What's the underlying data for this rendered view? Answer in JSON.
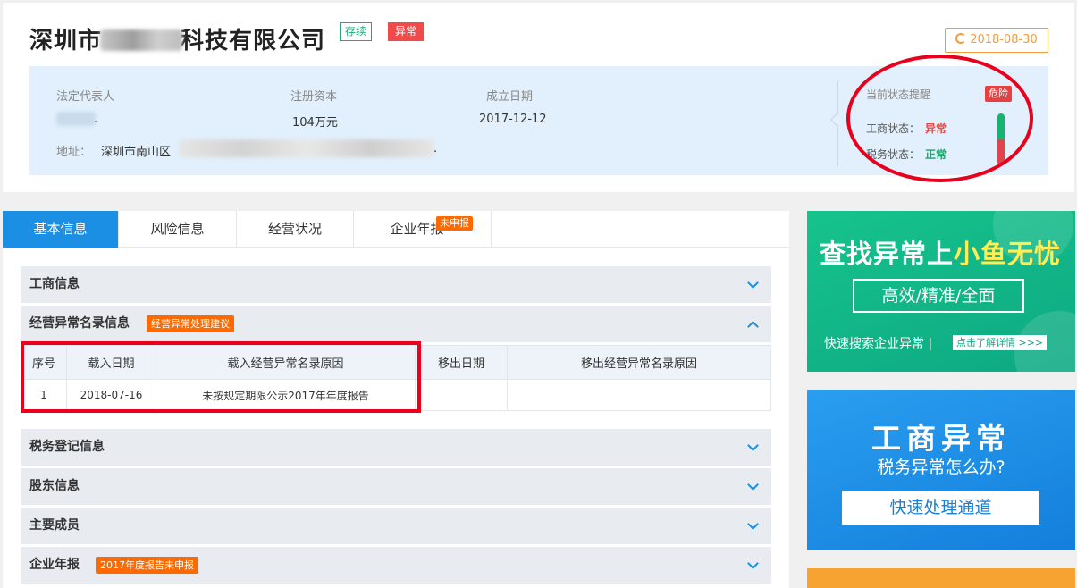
{
  "header": {
    "title_part1": "深圳市",
    "title_part2": "科技有限公司",
    "badge_status": "存续",
    "badge_abnormal": "异常",
    "date": "2018-08-30"
  },
  "info": {
    "legal_rep_label": "法定代表人",
    "capital_label": "注册资本",
    "capital_value": "104万元",
    "founded_label": "成立日期",
    "founded_value": "2017-12-12",
    "address_label": "地址：",
    "address_value": "深圳市南山区"
  },
  "status_panel": {
    "title": "当前状态提醒",
    "danger_label": "危险",
    "biz_label": "工商状态：",
    "biz_value": "异常",
    "tax_label": "税务状态：",
    "tax_value": "正常"
  },
  "tabs": [
    {
      "label": "基本信息"
    },
    {
      "label": "风险信息"
    },
    {
      "label": "经营状况"
    },
    {
      "label": "企业年报",
      "tag": "未申报"
    }
  ],
  "sections": {
    "s1": "工商信息",
    "s2": "经营异常名录信息",
    "s2_tag": "经营异常处理建议",
    "s3": "税务登记信息",
    "s4": "股东信息",
    "s5": "主要成员",
    "s6": "企业年报",
    "s6_tag": "2017年度报告未申报"
  },
  "abnormal_table": {
    "headers": [
      "序号",
      "载入日期",
      "载入经营异常名录原因",
      "移出日期",
      "移出经营异常名录原因"
    ],
    "rows": [
      [
        "1",
        "2018-07-16",
        "未按规定期限公示2017年年度报告",
        "",
        ""
      ]
    ]
  },
  "ads": {
    "green_headline": "查找异常上",
    "green_headline_highlight": "小鱼无忧",
    "green_pill": "高效/精准/全面",
    "green_tagline": "快速搜索企业异常 |",
    "green_more": "点击了解详情 >>>",
    "blue_big": "工商异常",
    "blue_sub": "税务异常怎么办?",
    "blue_button": "快速处理通道"
  },
  "colors": {
    "accent_blue": "#1a8fe3",
    "abnormal_red": "#f04a4a",
    "normal_green": "#1aa86a",
    "tag_orange": "#ff6a00",
    "annotation_red": "#e8001c"
  }
}
